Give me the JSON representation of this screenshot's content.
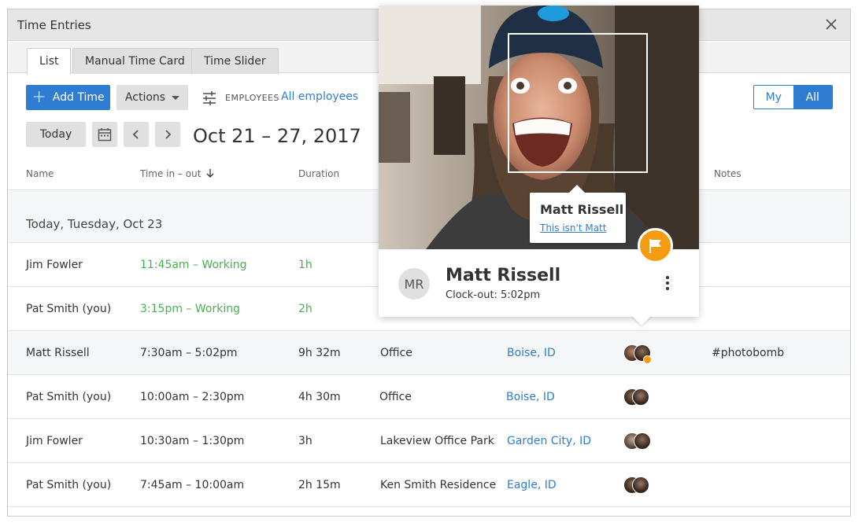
{
  "window": {
    "title": "Time Entries"
  },
  "tabs": [
    {
      "label": "List"
    },
    {
      "label": "Manual Time Card"
    },
    {
      "label": "Time Slider"
    }
  ],
  "toolbar": {
    "add_label": "Add Time",
    "actions_label": "Actions",
    "employees_label": "EMPLOYEES",
    "employees_value": "All employees",
    "toggle_my": "My",
    "toggle_all": "All"
  },
  "date": {
    "today_label": "Today",
    "range": "Oct 21 – 27, 2017"
  },
  "columns": {
    "name": "Name",
    "time": "Time in – out",
    "duration": "Duration",
    "notes": "Notes"
  },
  "group_label": "Today, Tuesday, Oct 23",
  "rows": [
    {
      "name": "Jim Fowler",
      "time": "11:45am – Working",
      "duration": "1h",
      "job": "",
      "location": "",
      "notes": ""
    },
    {
      "name": "Pat Smith (you)",
      "time": "3:15pm – Working",
      "duration": "2h",
      "job": "",
      "location": "",
      "notes": ""
    },
    {
      "name": "Matt Rissell",
      "time": "7:30am – 5:02pm",
      "duration": "9h 32m",
      "job": "Office",
      "location": "Boise, ID",
      "notes": "#photobomb"
    },
    {
      "name": "Pat Smith (you)",
      "time": "10:00am – 2:30pm",
      "duration": "4h 30m",
      "job": "Office",
      "location": "Boise, ID",
      "notes": ""
    },
    {
      "name": "Jim Fowler",
      "time": "10:30am – 1:30pm",
      "duration": "3h",
      "job": "Lakeview Office Park",
      "location": "Garden City, ID",
      "notes": ""
    },
    {
      "name": "Pat Smith (you)",
      "time": "7:45am – 10:00am",
      "duration": "2h 15m",
      "job": "Ken Smith Residence",
      "location": "Eagle, ID",
      "notes": ""
    }
  ],
  "popover": {
    "tip_name": "Matt Rissell",
    "tip_link": "This isn't Matt",
    "initials": "MR",
    "name": "Matt Rissell",
    "clockout": "Clock-out: 5:02pm"
  },
  "colors": {
    "accent": "#2f7cd3",
    "working": "#4caf50",
    "flag": "#f39c12"
  }
}
